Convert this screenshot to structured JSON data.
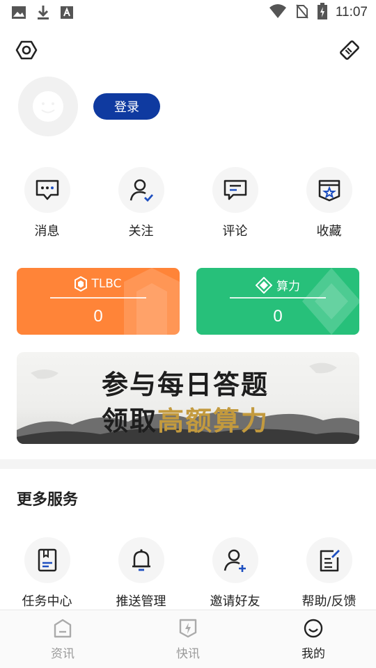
{
  "status_bar": {
    "time": "11:07"
  },
  "profile": {
    "login_label": "登录"
  },
  "quick_actions": [
    {
      "label": "消息",
      "icon": "message-icon"
    },
    {
      "label": "关注",
      "icon": "follow-icon"
    },
    {
      "label": "评论",
      "icon": "comment-icon"
    },
    {
      "label": "收藏",
      "icon": "favorite-icon"
    }
  ],
  "cards": {
    "tlbc": {
      "title": "TLBC",
      "value": "0",
      "color": "#ff8438"
    },
    "compute": {
      "title": "算力",
      "value": "0",
      "color": "#27c07a"
    }
  },
  "banner": {
    "line1": "参与每日答题",
    "line2_prefix": "领取",
    "line2_highlight": "高额算力"
  },
  "more_services": {
    "title": "更多服务",
    "items": [
      {
        "label": "任务中心",
        "icon": "task-center-icon"
      },
      {
        "label": "推送管理",
        "icon": "bell-icon"
      },
      {
        "label": "邀请好友",
        "icon": "invite-friend-icon"
      },
      {
        "label": "帮助/反馈",
        "icon": "feedback-icon"
      }
    ]
  },
  "bottom_nav": {
    "tabs": [
      {
        "label": "资讯",
        "icon": "news-icon",
        "active": false
      },
      {
        "label": "快讯",
        "icon": "flash-icon",
        "active": false
      },
      {
        "label": "我的",
        "icon": "profile-icon",
        "active": true
      }
    ]
  },
  "colors": {
    "primary": "#0f3aa0",
    "orange": "#ff8438",
    "green": "#27c07a"
  }
}
